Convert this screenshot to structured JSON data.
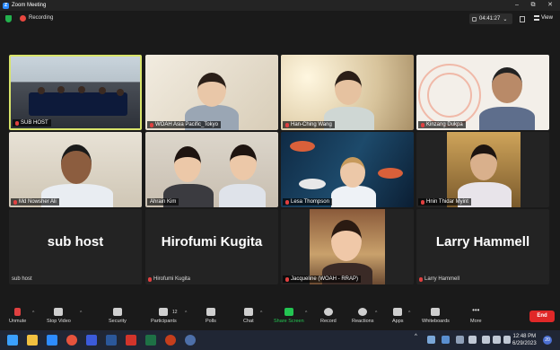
{
  "window": {
    "title": "Zoom Meeting",
    "minimize": "–",
    "maximize": "⧉",
    "close": "✕"
  },
  "meeting_bar": {
    "recording_label": "Recording",
    "timer": "04:41:27",
    "view_label": "View"
  },
  "tiles": [
    {
      "name": "SUB HOST"
    },
    {
      "name": "WOAH Asia Pacific_Tokyo"
    },
    {
      "name": "Han-Ching Wang"
    },
    {
      "name": "Kinzang Dukpa"
    },
    {
      "name": "Md Nowsher Ali"
    },
    {
      "name": "Ahrain Kim"
    },
    {
      "name": "Lesa Thompson"
    },
    {
      "name": "Hnin Thidar Myint"
    },
    {
      "name": "sub host",
      "big_name": "sub host"
    },
    {
      "name": "Hirofumi Kugita",
      "big_name": "Hirofumi Kugita"
    },
    {
      "name": "Jacqueline (WOAH - RRAP)"
    },
    {
      "name": "Larry Hammell",
      "big_name": "Larry Hammell"
    }
  ],
  "toolbar": {
    "unmute": "Unmute",
    "stop_video": "Stop Video",
    "security": "Security",
    "participants": "Participants",
    "participants_count": "12",
    "polls": "Polls",
    "chat": "Chat",
    "share_screen": "Share Screen",
    "record": "Record",
    "reactions": "Reactions",
    "apps": "Apps",
    "whiteboards": "Whiteboards",
    "more": "More",
    "end": "End"
  },
  "taskbar": {
    "time": "12:48 PM",
    "date": "6/29/2023",
    "notifications": "20"
  },
  "colors": {
    "active_speaker": "#d9e46b",
    "end_button": "#e02828",
    "share_green": "#23c552",
    "zoom_blue": "#2d8cff"
  }
}
